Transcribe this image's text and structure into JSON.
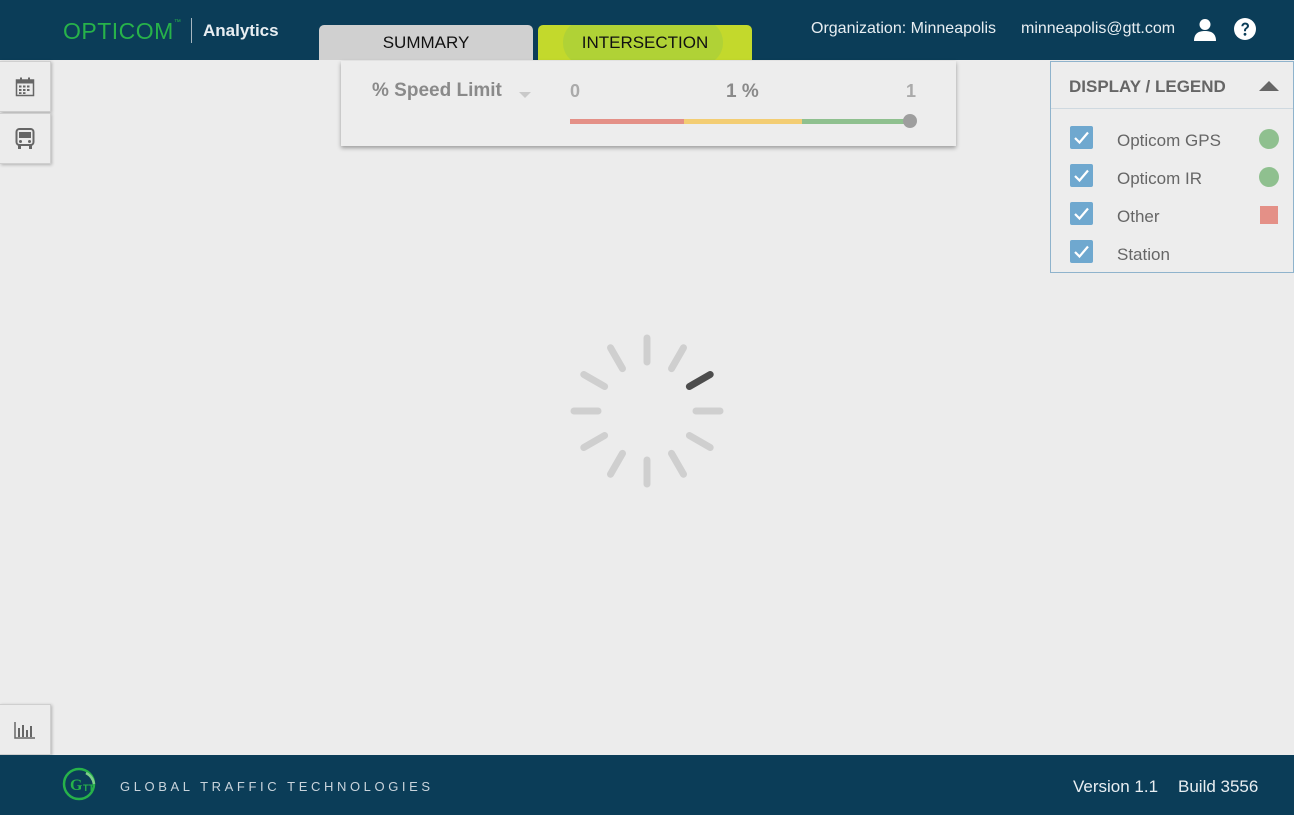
{
  "header": {
    "brand": "OPTICOM",
    "brand_tm": "™",
    "product": "Analytics",
    "organization": "Organization: Minneapolis",
    "email": "minneapolis@gtt.com"
  },
  "tabs": [
    {
      "label": "SUMMARY",
      "active": false
    },
    {
      "label": "INTERSECTION",
      "active": true
    }
  ],
  "speed_filter": {
    "metric": "% Speed Limit",
    "min": "0",
    "value": "1 %",
    "max": "1",
    "colors": [
      "#e49087",
      "#f3cd73",
      "#8fc08f"
    ]
  },
  "legend": {
    "title": "DISPLAY / LEGEND",
    "items": [
      {
        "label": "Opticom GPS",
        "checked": true,
        "marker": "circle",
        "color": "#8fc08f"
      },
      {
        "label": "Opticom IR",
        "checked": true,
        "marker": "circle",
        "color": "#8fc08f"
      },
      {
        "label": "Other",
        "checked": true,
        "marker": "square",
        "color": "#e49087"
      },
      {
        "label": "Station",
        "checked": true,
        "marker": "none",
        "color": ""
      }
    ]
  },
  "sidebar": {
    "icons": [
      "calendar-icon",
      "bus-icon",
      "bar-chart-icon"
    ]
  },
  "footer": {
    "company": "GLOBAL TRAFFIC TECHNOLOGIES",
    "version": "Version 1.1",
    "build": "Build 3556"
  },
  "theme": {
    "header_bg": "#0b3d58",
    "brand_green": "#27b24a",
    "active_tab": "#c3d92c",
    "checkbox": "#6fa8cf"
  }
}
